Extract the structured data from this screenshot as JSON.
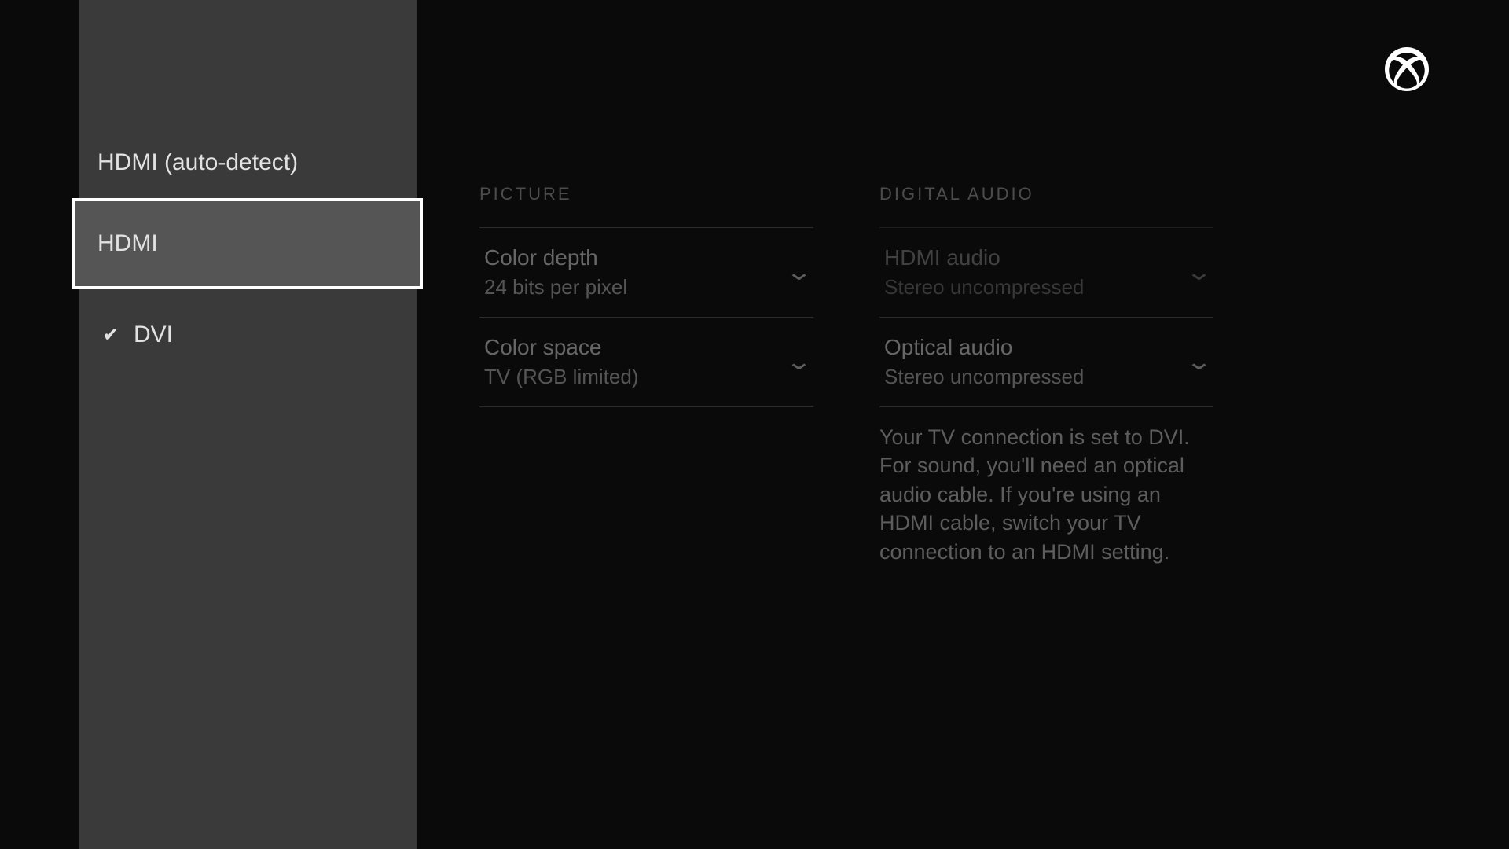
{
  "sidebar": {
    "items": [
      {
        "label": "HDMI (auto-detect)",
        "checked": false,
        "selected": false
      },
      {
        "label": "HDMI",
        "checked": false,
        "selected": true
      },
      {
        "label": "DVI",
        "checked": true,
        "selected": false
      }
    ]
  },
  "picture": {
    "title": "PICTURE",
    "color_depth": {
      "label": "Color depth",
      "value": "24 bits per pixel"
    },
    "color_space": {
      "label": "Color space",
      "value": "TV (RGB limited)"
    }
  },
  "audio": {
    "title": "DIGITAL AUDIO",
    "hdmi_audio": {
      "label": "HDMI audio",
      "value": "Stereo uncompressed",
      "disabled": true
    },
    "optical_audio": {
      "label": "Optical audio",
      "value": "Stereo uncompressed"
    },
    "info": "Your TV connection is set to DVI. For sound, you'll need an optical audio cable. If you're using an HDMI cable, switch your TV connection to an HDMI setting."
  },
  "icons": {
    "check": "✔",
    "chevron_down": "⌄"
  }
}
